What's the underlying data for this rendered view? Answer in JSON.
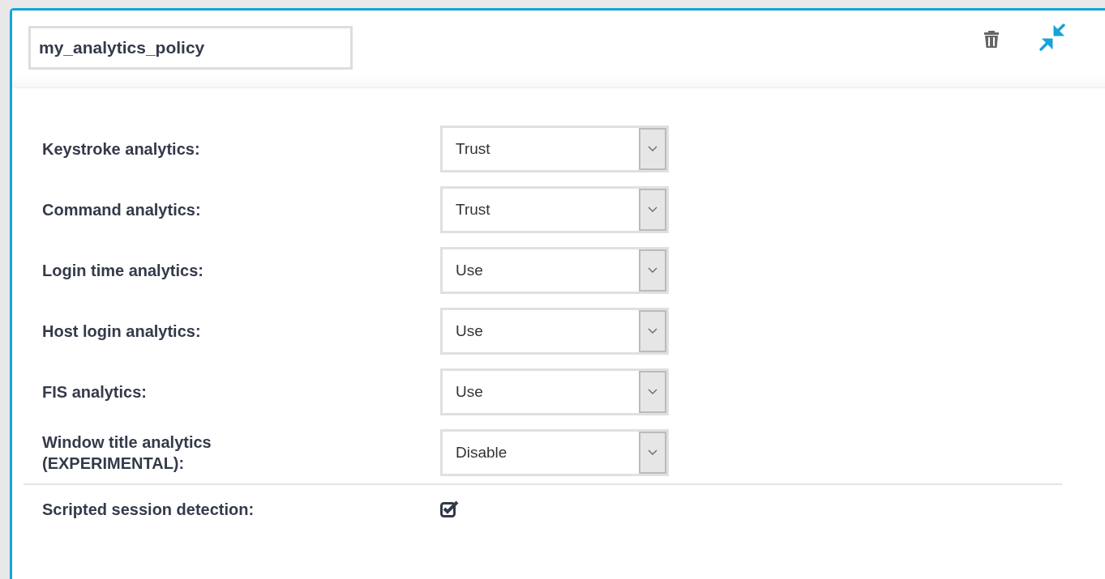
{
  "policy": {
    "name": "my_analytics_policy"
  },
  "settings": [
    {
      "kind": "select",
      "label": "Keystroke analytics:",
      "value": "Trust"
    },
    {
      "kind": "select",
      "label": "Command analytics:",
      "value": "Trust"
    },
    {
      "kind": "select",
      "label": "Login time analytics:",
      "value": "Use"
    },
    {
      "kind": "select",
      "label": "Host login analytics:",
      "value": "Use"
    },
    {
      "kind": "select",
      "label": "FIS analytics:",
      "value": "Use"
    },
    {
      "kind": "select",
      "label": "Window title analytics (EXPERIMENTAL):",
      "value": "Disable"
    },
    {
      "kind": "checkbox",
      "label": "Scripted session detection:",
      "checked": true
    }
  ]
}
